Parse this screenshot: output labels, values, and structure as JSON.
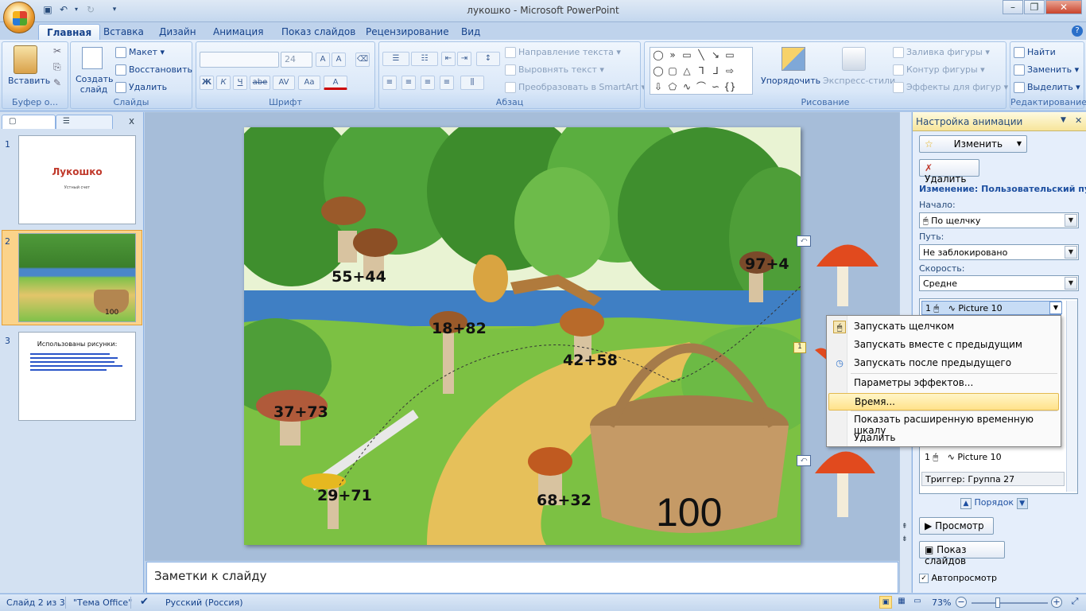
{
  "window": {
    "title": "лукошко - Microsoft PowerPoint"
  },
  "tabs": [
    "Главная",
    "Вставка",
    "Дизайн",
    "Анимация",
    "Показ слайдов",
    "Рецензирование",
    "Вид"
  ],
  "ribbon": {
    "clipboard": {
      "paste": "Вставить",
      "group": "Буфер о..."
    },
    "slides": {
      "new_slide": "Создать слайд",
      "layout": "Макет",
      "reset": "Восстановить",
      "delete": "Удалить",
      "group": "Слайды"
    },
    "font": {
      "size": "24",
      "bold": "Ж",
      "italic": "К",
      "underline": "Ч",
      "strike": "abe",
      "spacing": "AV",
      "case": "Aa",
      "group": "Шрифт"
    },
    "paragraph": {
      "text_direction": "Направление текста",
      "align_text": "Выровнять текст",
      "smartart": "Преобразовать в SmartArt",
      "group": "Абзац"
    },
    "drawing": {
      "arrange": "Упорядочить",
      "quick_styles": "Экспресс-стили",
      "fill": "Заливка фигуры",
      "outline": "Контур фигуры",
      "effects": "Эффекты для фигур",
      "group": "Рисование"
    },
    "editing": {
      "find": "Найти",
      "replace": "Заменить",
      "select": "Выделить",
      "group": "Редактирование"
    }
  },
  "slides_panel": {
    "slides": [
      {
        "num": "1",
        "title": "Лукошко",
        "subtitle": "Устный счет"
      },
      {
        "num": "2"
      },
      {
        "num": "3",
        "title": "Использованы рисунки:"
      }
    ]
  },
  "slide": {
    "labels": [
      "55+44",
      "97+4",
      "18+82",
      "42+58",
      "37+73",
      "29+71",
      "68+32"
    ],
    "basket_number": "100"
  },
  "notes": {
    "placeholder": "Заметки к слайду"
  },
  "animation_pane": {
    "title": "Настройка анимации",
    "change": "Изменить",
    "remove": "Удалить",
    "effect_heading": "Изменение: Пользовательский пут",
    "start_label": "Начало:",
    "start_value": "По щелчку",
    "path_label": "Путь:",
    "path_value": "Не заблокировано",
    "speed_label": "Скорость:",
    "speed_value": "Средне",
    "item_top": {
      "num": "1",
      "name": "Picture 10"
    },
    "item_bottom": {
      "num": "1",
      "name": "Picture 10"
    },
    "trigger": "Триггер: Группа 27",
    "reorder": "Порядок",
    "play": "Просмотр",
    "slideshow": "Показ слайдов",
    "autopreview": "Автопросмотр"
  },
  "context_menu": {
    "items": [
      "Запускать щелчком",
      "Запускать вместе с предыдущим",
      "Запускать после предыдущего",
      "Параметры эффектов...",
      "Время...",
      "Показать расширенную временную шкалу",
      "Удалить"
    ],
    "highlighted": "Время..."
  },
  "status": {
    "slide": "Слайд 2 из 3",
    "theme": "\"Тема Office\"",
    "language": "Русский (Россия)",
    "zoom": "73%"
  }
}
